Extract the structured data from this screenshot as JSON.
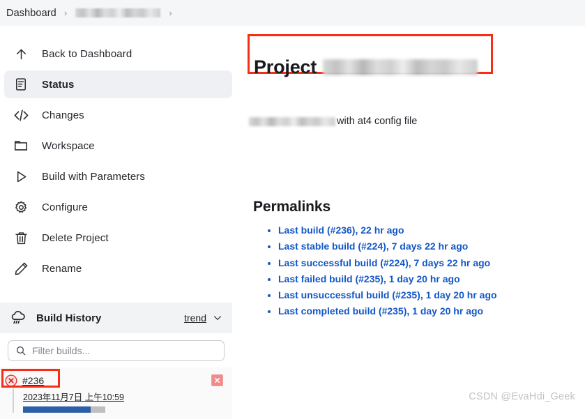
{
  "breadcrumb": {
    "items": [
      {
        "label": "Dashboard",
        "redacted": false
      },
      {
        "label": "",
        "redacted": true
      }
    ],
    "separator": "›"
  },
  "sidebar": {
    "items": [
      {
        "label": "Back to Dashboard",
        "icon": "arrow-up-icon",
        "active": false
      },
      {
        "label": "Status",
        "icon": "document-icon",
        "active": true
      },
      {
        "label": "Changes",
        "icon": "code-icon",
        "active": false
      },
      {
        "label": "Workspace",
        "icon": "folder-icon",
        "active": false
      },
      {
        "label": "Build with Parameters",
        "icon": "play-icon",
        "active": false
      },
      {
        "label": "Configure",
        "icon": "gear-icon",
        "active": false
      },
      {
        "label": "Delete Project",
        "icon": "trash-icon",
        "active": false
      },
      {
        "label": "Rename",
        "icon": "pencil-icon",
        "active": false
      }
    ]
  },
  "build_history": {
    "title": "Build History",
    "icon": "weather-cloud-rain-icon",
    "trend_label": "trend",
    "chevron_icon": "chevron-down-icon",
    "filter": {
      "placeholder": "Filter builds...",
      "value": "",
      "icon": "search-icon"
    },
    "builds": [
      {
        "number": "#236",
        "status_icon": "failed-x-icon",
        "timestamp": "2023年11月7日 上午10:59",
        "progress_percent": 82,
        "stop_icon": "stop-x-icon",
        "highlighted": true
      }
    ]
  },
  "main": {
    "title_prefix": "Project",
    "title_redacted": true,
    "description_redacted": true,
    "description_suffix": "with at4 config file",
    "permalinks_heading": "Permalinks",
    "permalinks": [
      {
        "label": "Last build (#236), 22 hr ago"
      },
      {
        "label": "Last stable build (#224), 7 days 22 hr ago"
      },
      {
        "label": "Last successful build (#224), 7 days 22 hr ago"
      },
      {
        "label": "Last failed build (#235), 1 day 20 hr ago"
      },
      {
        "label": "Last unsuccessful build (#235), 1 day 20 hr ago"
      },
      {
        "label": "Last completed build (#235), 1 day 20 hr ago"
      }
    ]
  },
  "watermark": "CSDN @EvaHdi_Geek",
  "colors": {
    "annotation_red": "#f92c15",
    "link_blue": "#1357c8",
    "progress_blue": "#2c5fa8",
    "progress_track": "#bfbfbf",
    "panel_gray": "#f2f3f5",
    "active_nav": "#eef0f3"
  }
}
